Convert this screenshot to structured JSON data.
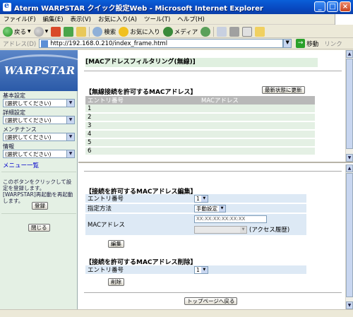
{
  "window": {
    "title": "Aterm WARPSTAR クイック設定Web - Microsoft Internet Explorer",
    "minimize": "_",
    "maximize": "□",
    "close": "×"
  },
  "menubar": {
    "items": [
      "ファイル(F)",
      "編集(E)",
      "表示(V)",
      "お気に入り(A)",
      "ツール(T)",
      "ヘルプ(H)"
    ]
  },
  "toolbar": {
    "back_label": "戻る",
    "search_label": "検索",
    "favorites_label": "お気に入り",
    "media_label": "メディア"
  },
  "addressbar": {
    "label": "アドレス(D)",
    "url": "http://192.168.0.210/index_frame.html",
    "go_label": "移動",
    "links_label": "リンク"
  },
  "sidebar": {
    "logo_text": "WARPSTAR",
    "groups": [
      {
        "label": "基本設定",
        "selected": "(選択してください)"
      },
      {
        "label": "詳細設定",
        "selected": "(選択してください)"
      },
      {
        "label": "メンテナンス",
        "selected": "(選択してください)"
      },
      {
        "label": "情報",
        "selected": "(選択してください)"
      }
    ],
    "menu_list_link": "メニュー一覧",
    "note": "このボタンをクリックして設定を登録します。[WARPSTAR]再起動を再起動します。",
    "register_button": "登録",
    "close_button": "閉じる"
  },
  "top_frame": {
    "page_title": "[MACアドレスフィルタリング(無線)]",
    "allowed_section_title": "【無線接続を許可するMACアドレス】",
    "refresh_button": "最新状態に更新",
    "table_headers": [
      "エントリ番号",
      "MACアドレス"
    ],
    "rows": [
      "1",
      "2",
      "3",
      "4",
      "5",
      "6"
    ]
  },
  "bottom_frame": {
    "edit_section_title": "【接続を許可するMACアドレス編集】",
    "entry_label": "エントリ番号",
    "entry_value": "1",
    "method_label": "指定方法",
    "method_value": "手動設定",
    "mac_label": "MACアドレス",
    "mac_value": "XX:XX:XX:XX:XX:XX",
    "access_history_label": "(アクセス履歴)",
    "edit_button": "編集",
    "delete_section_title": "【接続を許可するMACアドレス削除】",
    "delete_entry_label": "エントリ番号",
    "delete_entry_value": "1",
    "delete_button": "削除",
    "top_page_button": "トップページへ戻る"
  }
}
